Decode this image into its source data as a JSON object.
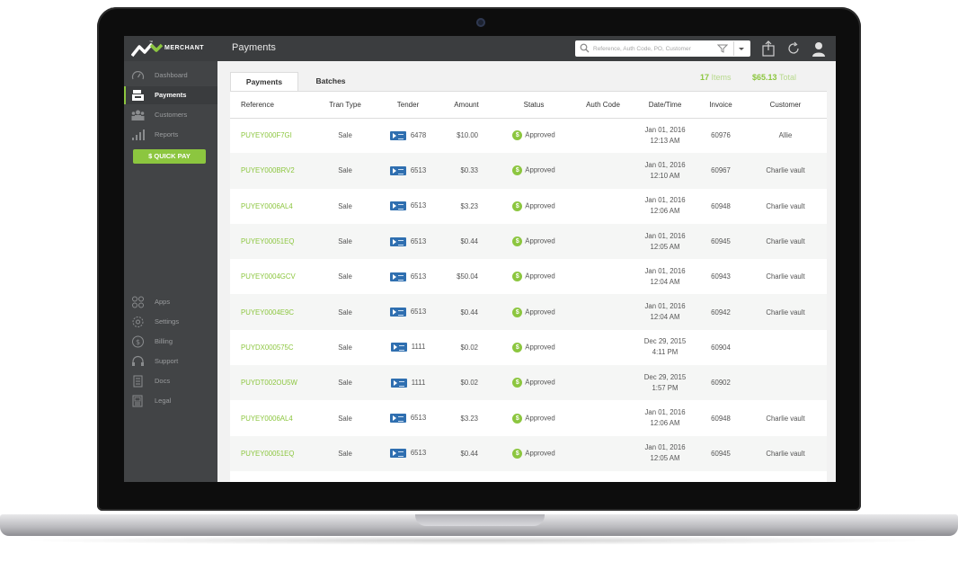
{
  "brand": {
    "name": "MERCHANT",
    "tm": "™",
    "accent": "#8cc63f"
  },
  "header": {
    "title": "Payments"
  },
  "search": {
    "placeholder": "Reference, Auth Code, PO, Customer"
  },
  "sidebar": {
    "top_items": [
      {
        "label": "Dashboard",
        "icon": "gauge-icon"
      },
      {
        "label": "Payments",
        "icon": "register-icon",
        "active": true
      },
      {
        "label": "Customers",
        "icon": "people-icon"
      },
      {
        "label": "Reports",
        "icon": "bar-chart-icon"
      }
    ],
    "quick_pay": "$ QUICK PAY",
    "bottom_items": [
      {
        "label": "Apps",
        "icon": "apps-grid-icon"
      },
      {
        "label": "Settings",
        "icon": "gear-icon"
      },
      {
        "label": "Billing",
        "icon": "dollar-circle-icon"
      },
      {
        "label": "Support",
        "icon": "headset-icon"
      },
      {
        "label": "Docs",
        "icon": "document-icon"
      },
      {
        "label": "Legal",
        "icon": "legal-document-icon"
      }
    ]
  },
  "tabs": [
    {
      "label": "Payments",
      "active": true
    },
    {
      "label": "Batches"
    }
  ],
  "summary": {
    "items_count": "17",
    "items_label": "Items",
    "total_amount": "$65.13",
    "total_label": "Total"
  },
  "table": {
    "columns": [
      "Reference",
      "Tran Type",
      "Tender",
      "Amount",
      "Status",
      "Auth Code",
      "Date/Time",
      "Invoice",
      "Customer"
    ],
    "rows": [
      {
        "reference": "PUYEY000F7GI",
        "tran_type": "Sale",
        "tender": "6478",
        "amount": "$10.00",
        "status": "Approved",
        "auth_code": "",
        "date": "Jan 01, 2016",
        "time": "12:13 AM",
        "invoice": "60976",
        "customer": "Allie"
      },
      {
        "reference": "PUYEY000BRV2",
        "tran_type": "Sale",
        "tender": "6513",
        "amount": "$0.33",
        "status": "Approved",
        "auth_code": "",
        "date": "Jan 01, 2016",
        "time": "12:10 AM",
        "invoice": "60967",
        "customer": "Charlie vault"
      },
      {
        "reference": "PUYEY0006AL4",
        "tran_type": "Sale",
        "tender": "6513",
        "amount": "$3.23",
        "status": "Approved",
        "auth_code": "",
        "date": "Jan 01, 2016",
        "time": "12:06 AM",
        "invoice": "60948",
        "customer": "Charlie vault"
      },
      {
        "reference": "PUYEY00051EQ",
        "tran_type": "Sale",
        "tender": "6513",
        "amount": "$0.44",
        "status": "Approved",
        "auth_code": "",
        "date": "Jan 01, 2016",
        "time": "12:05 AM",
        "invoice": "60945",
        "customer": "Charlie vault"
      },
      {
        "reference": "PUYEY0004GCV",
        "tran_type": "Sale",
        "tender": "6513",
        "amount": "$50.04",
        "status": "Approved",
        "auth_code": "",
        "date": "Jan 01, 2016",
        "time": "12:04 AM",
        "invoice": "60943",
        "customer": "Charlie vault"
      },
      {
        "reference": "PUYEY0004E9C",
        "tran_type": "Sale",
        "tender": "6513",
        "amount": "$0.44",
        "status": "Approved",
        "auth_code": "",
        "date": "Jan 01, 2016",
        "time": "12:04 AM",
        "invoice": "60942",
        "customer": "Charlie vault"
      },
      {
        "reference": "PUYDX000575C",
        "tran_type": "Sale",
        "tender": "1111",
        "amount": "$0.02",
        "status": "Approved",
        "auth_code": "",
        "date": "Dec 29, 2015",
        "time": "4:11 PM",
        "invoice": "60904",
        "customer": ""
      },
      {
        "reference": "PUYDT002OU5W",
        "tran_type": "Sale",
        "tender": "1111",
        "amount": "$0.02",
        "status": "Approved",
        "auth_code": "",
        "date": "Dec 29, 2015",
        "time": "1:57 PM",
        "invoice": "60902",
        "customer": ""
      },
      {
        "reference": "PUYEY0006AL4",
        "tran_type": "Sale",
        "tender": "6513",
        "amount": "$3.23",
        "status": "Approved",
        "auth_code": "",
        "date": "Jan 01, 2016",
        "time": "12:06 AM",
        "invoice": "60948",
        "customer": "Charlie vault"
      },
      {
        "reference": "PUYEY00051EQ",
        "tran_type": "Sale",
        "tender": "6513",
        "amount": "$0.44",
        "status": "Approved",
        "auth_code": "",
        "date": "Jan 01, 2016",
        "time": "12:05 AM",
        "invoice": "60945",
        "customer": "Charlie vault"
      }
    ]
  }
}
